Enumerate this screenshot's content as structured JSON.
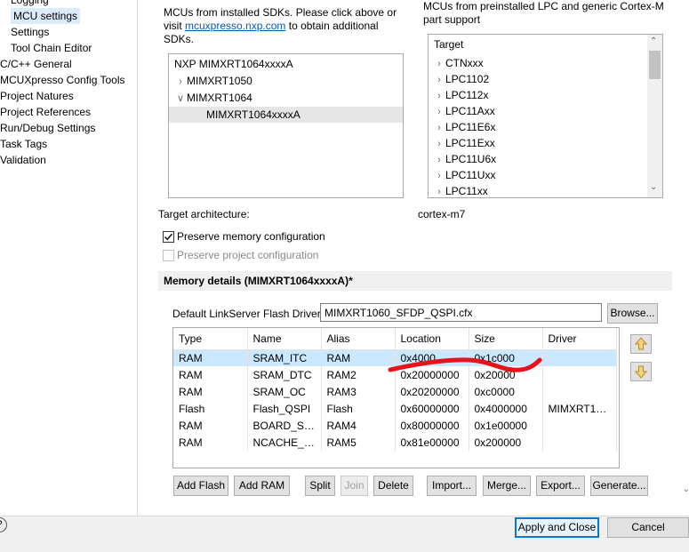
{
  "nav": {
    "items": [
      {
        "label": "Logging",
        "indent": true
      },
      {
        "label": "MCU settings",
        "indent": true,
        "selected": true
      },
      {
        "label": "Settings",
        "indent": true
      },
      {
        "label": "Tool Chain Editor",
        "indent": true
      },
      {
        "label": "C/C++ General",
        "indent": false
      },
      {
        "label": "MCUXpresso Config Tools",
        "indent": false
      },
      {
        "label": "Project Natures",
        "indent": false
      },
      {
        "label": "Project References",
        "indent": false
      },
      {
        "label": "Run/Debug Settings",
        "indent": false
      },
      {
        "label": "Task Tags",
        "indent": false
      },
      {
        "label": "Validation",
        "indent": false
      }
    ]
  },
  "sdk_panel": {
    "intro_line1": "MCUs from installed SDKs. Please click above or",
    "intro_visit": "visit",
    "intro_link": "mcuxpresso.nxp.com",
    "intro_after_link": "to obtain additional",
    "intro_line3": "SDKs.",
    "tree": [
      {
        "label": "NXP MIMXRT1064xxxxA",
        "level": 0,
        "chevron": ""
      },
      {
        "label": "MIMXRT1050",
        "level": 1,
        "chevron": ">"
      },
      {
        "label": "MIMXRT1064",
        "level": 1,
        "chevron": "v"
      },
      {
        "label": "MIMXRT1064xxxxA",
        "level": 2,
        "chevron": "",
        "selected": true
      }
    ]
  },
  "lpc_panel": {
    "intro_line1": "MCUs from preinstalled LPC and generic Cortex-M",
    "intro_line2": "part support",
    "header": "Target",
    "items": [
      "CTNxxx",
      "LPC1102",
      "LPC112x",
      "LPC11Axx",
      "LPC11E6x",
      "LPC11Exx",
      "LPC11U6x",
      "LPC11Uxx",
      "LPC11xx"
    ]
  },
  "target_arch": {
    "label": "Target architecture:",
    "value": "cortex-m7"
  },
  "preserve_memory": {
    "label": "Preserve memory configuration",
    "checked": true
  },
  "preserve_project": {
    "label": "Preserve project configuration",
    "checked": false,
    "disabled": true
  },
  "memory": {
    "title": "Memory details (MIMXRT1064xxxxA)*",
    "flash_driver_label": "Default LinkServer Flash Driver",
    "flash_driver_value": "MIMXRT1060_SFDP_QSPI.cfx",
    "browse": "Browse...",
    "columns": [
      "Type",
      "Name",
      "Alias",
      "Location",
      "Size",
      "Driver"
    ],
    "rows": [
      [
        "RAM",
        "SRAM_ITC",
        "RAM",
        "0x4000",
        "0x1c000",
        ""
      ],
      [
        "RAM",
        "SRAM_DTC",
        "RAM2",
        "0x20000000",
        "0x20000",
        ""
      ],
      [
        "RAM",
        "SRAM_OC",
        "RAM3",
        "0x20200000",
        "0xc0000",
        ""
      ],
      [
        "Flash",
        "Flash_QSPI",
        "Flash",
        "0x60000000",
        "0x4000000",
        "MIMXRT10..."
      ],
      [
        "RAM",
        "BOARD_SD...",
        "RAM4",
        "0x80000000",
        "0x1e00000",
        ""
      ],
      [
        "RAM",
        "NCACHE_R...",
        "RAM5",
        "0x81e00000",
        "0x200000",
        ""
      ]
    ],
    "buttons": {
      "add_flash": "Add Flash",
      "add_ram": "Add RAM",
      "split": "Split",
      "join": "Join",
      "delete": "Delete",
      "import": "Import...",
      "merge": "Merge...",
      "export": "Export...",
      "generate": "Generate..."
    }
  },
  "footer": {
    "apply_close": "Apply and Close",
    "cancel": "Cancel"
  },
  "colors": {
    "selection": "#cce8ff",
    "annotation": "#e8121b",
    "link": "#0b57b0"
  }
}
